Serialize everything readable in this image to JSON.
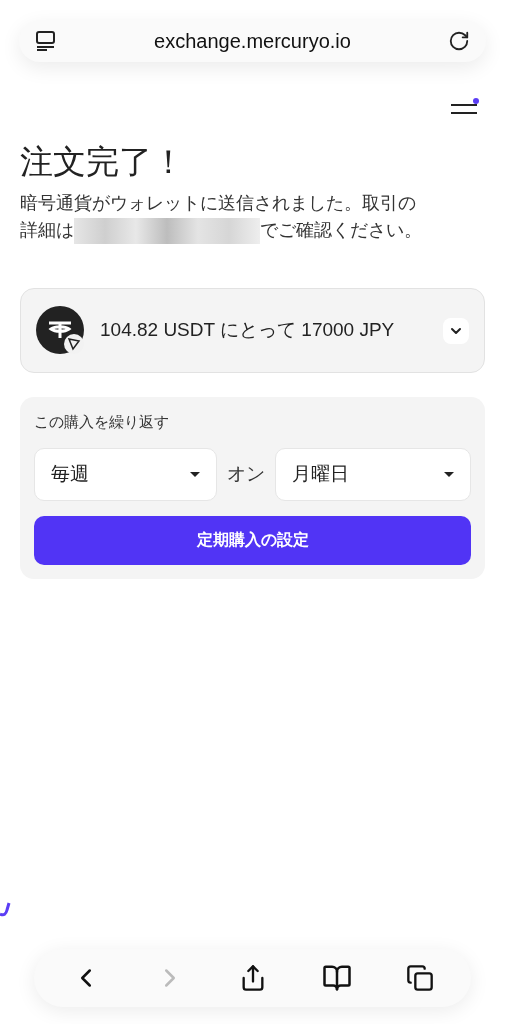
{
  "browser": {
    "url": "exchange.mercuryo.io"
  },
  "header": {
    "menu_badge": true
  },
  "title": "注文完了！",
  "message": {
    "line_1": "暗号通貨がウォレットに送信されました。取引の",
    "line_2_before": "詳細は",
    "line_2_after": "でご確認ください。"
  },
  "order": {
    "summary": "104.82 USDT にとって 17000 JPY",
    "expanded": false
  },
  "repeat": {
    "label": "この購入を繰り返す",
    "frequency": "毎週",
    "joiner": "オン",
    "day": "月曜日",
    "button": "定期購入の設定"
  },
  "toolbar": {
    "back_disabled": false,
    "forward_disabled": true
  }
}
